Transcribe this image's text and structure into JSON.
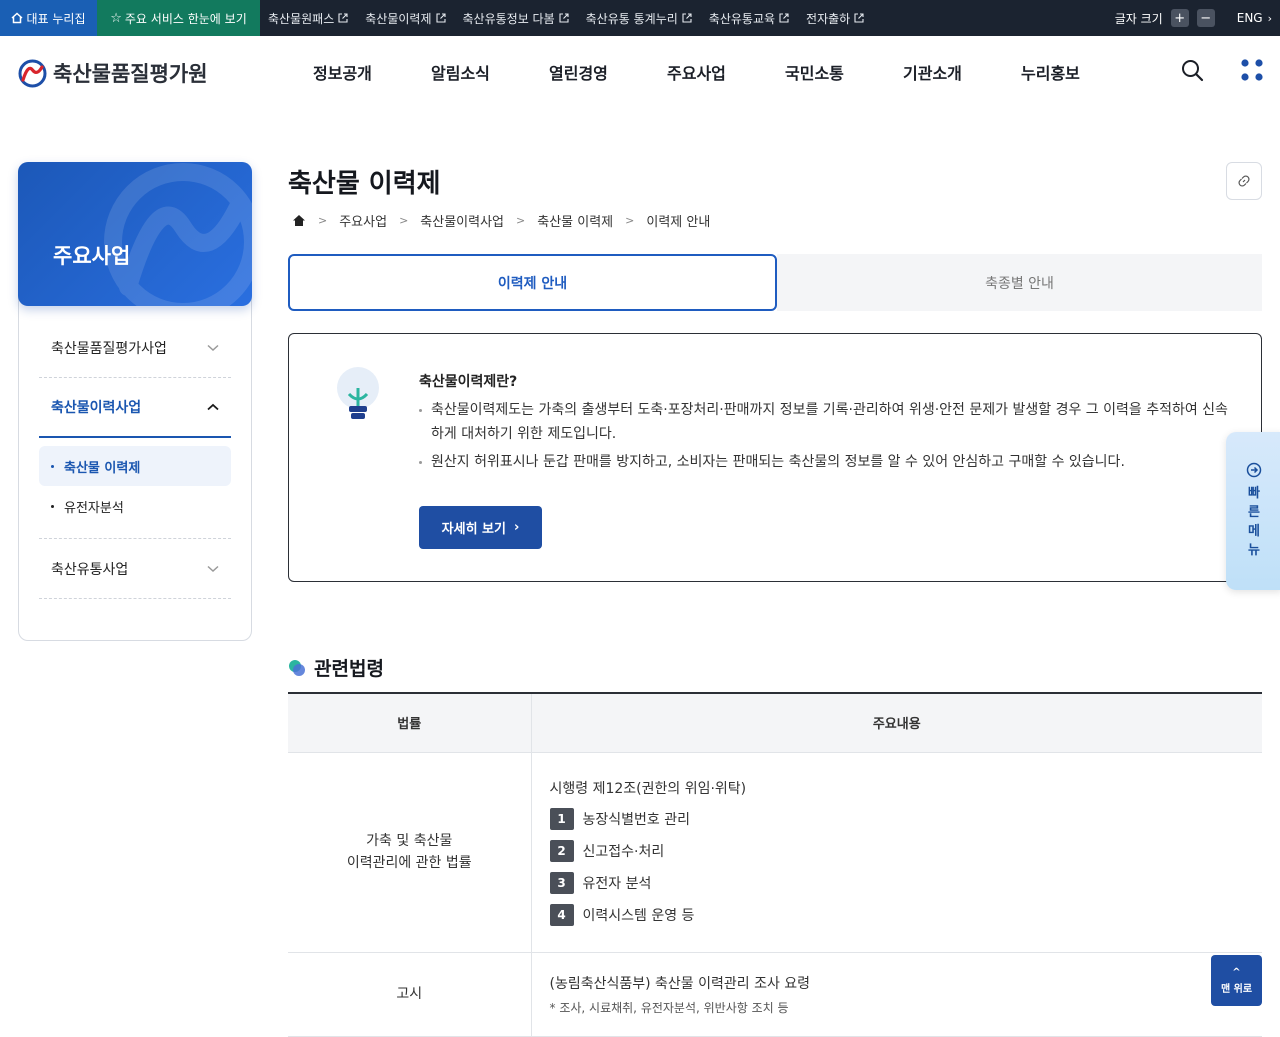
{
  "topbar": {
    "home_label": "대표 누리집",
    "main_label": "주요 서비스 한눈에 보기",
    "links": [
      "축산물원패스",
      "축산물이력제",
      "축산유통정보 다봄",
      "축산유통 통계누리",
      "축산유통교육",
      "전자출하"
    ],
    "font_size_label": "글자 크기",
    "plus": "+",
    "minus": "−",
    "lang": "ENG"
  },
  "header": {
    "logo_text": "축산물품질평가원",
    "gnb": [
      "정보공개",
      "알림소식",
      "열린경영",
      "주요사업",
      "국민소통",
      "기관소개",
      "누리홍보"
    ]
  },
  "lnb": {
    "title": "주요사업",
    "items": [
      {
        "label": "축산물품질평가사업"
      },
      {
        "label": "축산물이력사업"
      },
      {
        "label": "축산유통사업"
      }
    ],
    "sub_items": [
      "축산물 이력제",
      "유전자분석"
    ]
  },
  "page": {
    "title": "축산물 이력제",
    "breadcrumb": [
      "주요사업",
      "축산물이력사업",
      "축산물 이력제",
      "이력제 안내"
    ],
    "tabs": [
      "이력제 안내",
      "축종별 안내"
    ]
  },
  "info": {
    "title": "축산물이력제란?",
    "bullets": [
      "축산물이력제도는 가축의 출생부터 도축·포장처리·판매까지 정보를 기록·관리하여 위생·안전 문제가 발생할 경우 그 이력을 추적하여 신속하게 대처하기 위한 제도입니다.",
      "원산지 허위표시나 둔갑 판매를 방지하고, 소비자는 판매되는 축산물의 정보를 알 수 있어 안심하고 구매할 수 있습니다."
    ],
    "more_label": "자세히 보기"
  },
  "quick_menu": {
    "label": "빠른메뉴"
  },
  "section": {
    "title": "관련법령"
  },
  "law_table": {
    "headers": [
      "법률",
      "주요내용"
    ],
    "rows": [
      {
        "law_line1": "가축 및 축산물",
        "law_line2": "이력관리에 관한 법률",
        "heading": "시행령 제12조(권한의 위임·위탁)",
        "items": [
          {
            "n": "1",
            "text": "농장식별번호 관리"
          },
          {
            "n": "2",
            "text": "신고접수·처리"
          },
          {
            "n": "3",
            "text": "유전자 분석"
          },
          {
            "n": "4",
            "text": "이력시스템 운영 등"
          }
        ]
      },
      {
        "law_line1": "고시",
        "heading": "(농림축산식품부) 축산물 이력관리 조사 요령",
        "note": "* 조사, 시료채취, 유전자분석, 위반사항 조치 등"
      }
    ]
  },
  "top_button": {
    "label": "맨 위로"
  },
  "colors": {
    "primary": "#1f4ea3",
    "topbar_bg": "#1b2330",
    "home_bg": "#1a5fb4",
    "main_bg": "#127a5e"
  }
}
